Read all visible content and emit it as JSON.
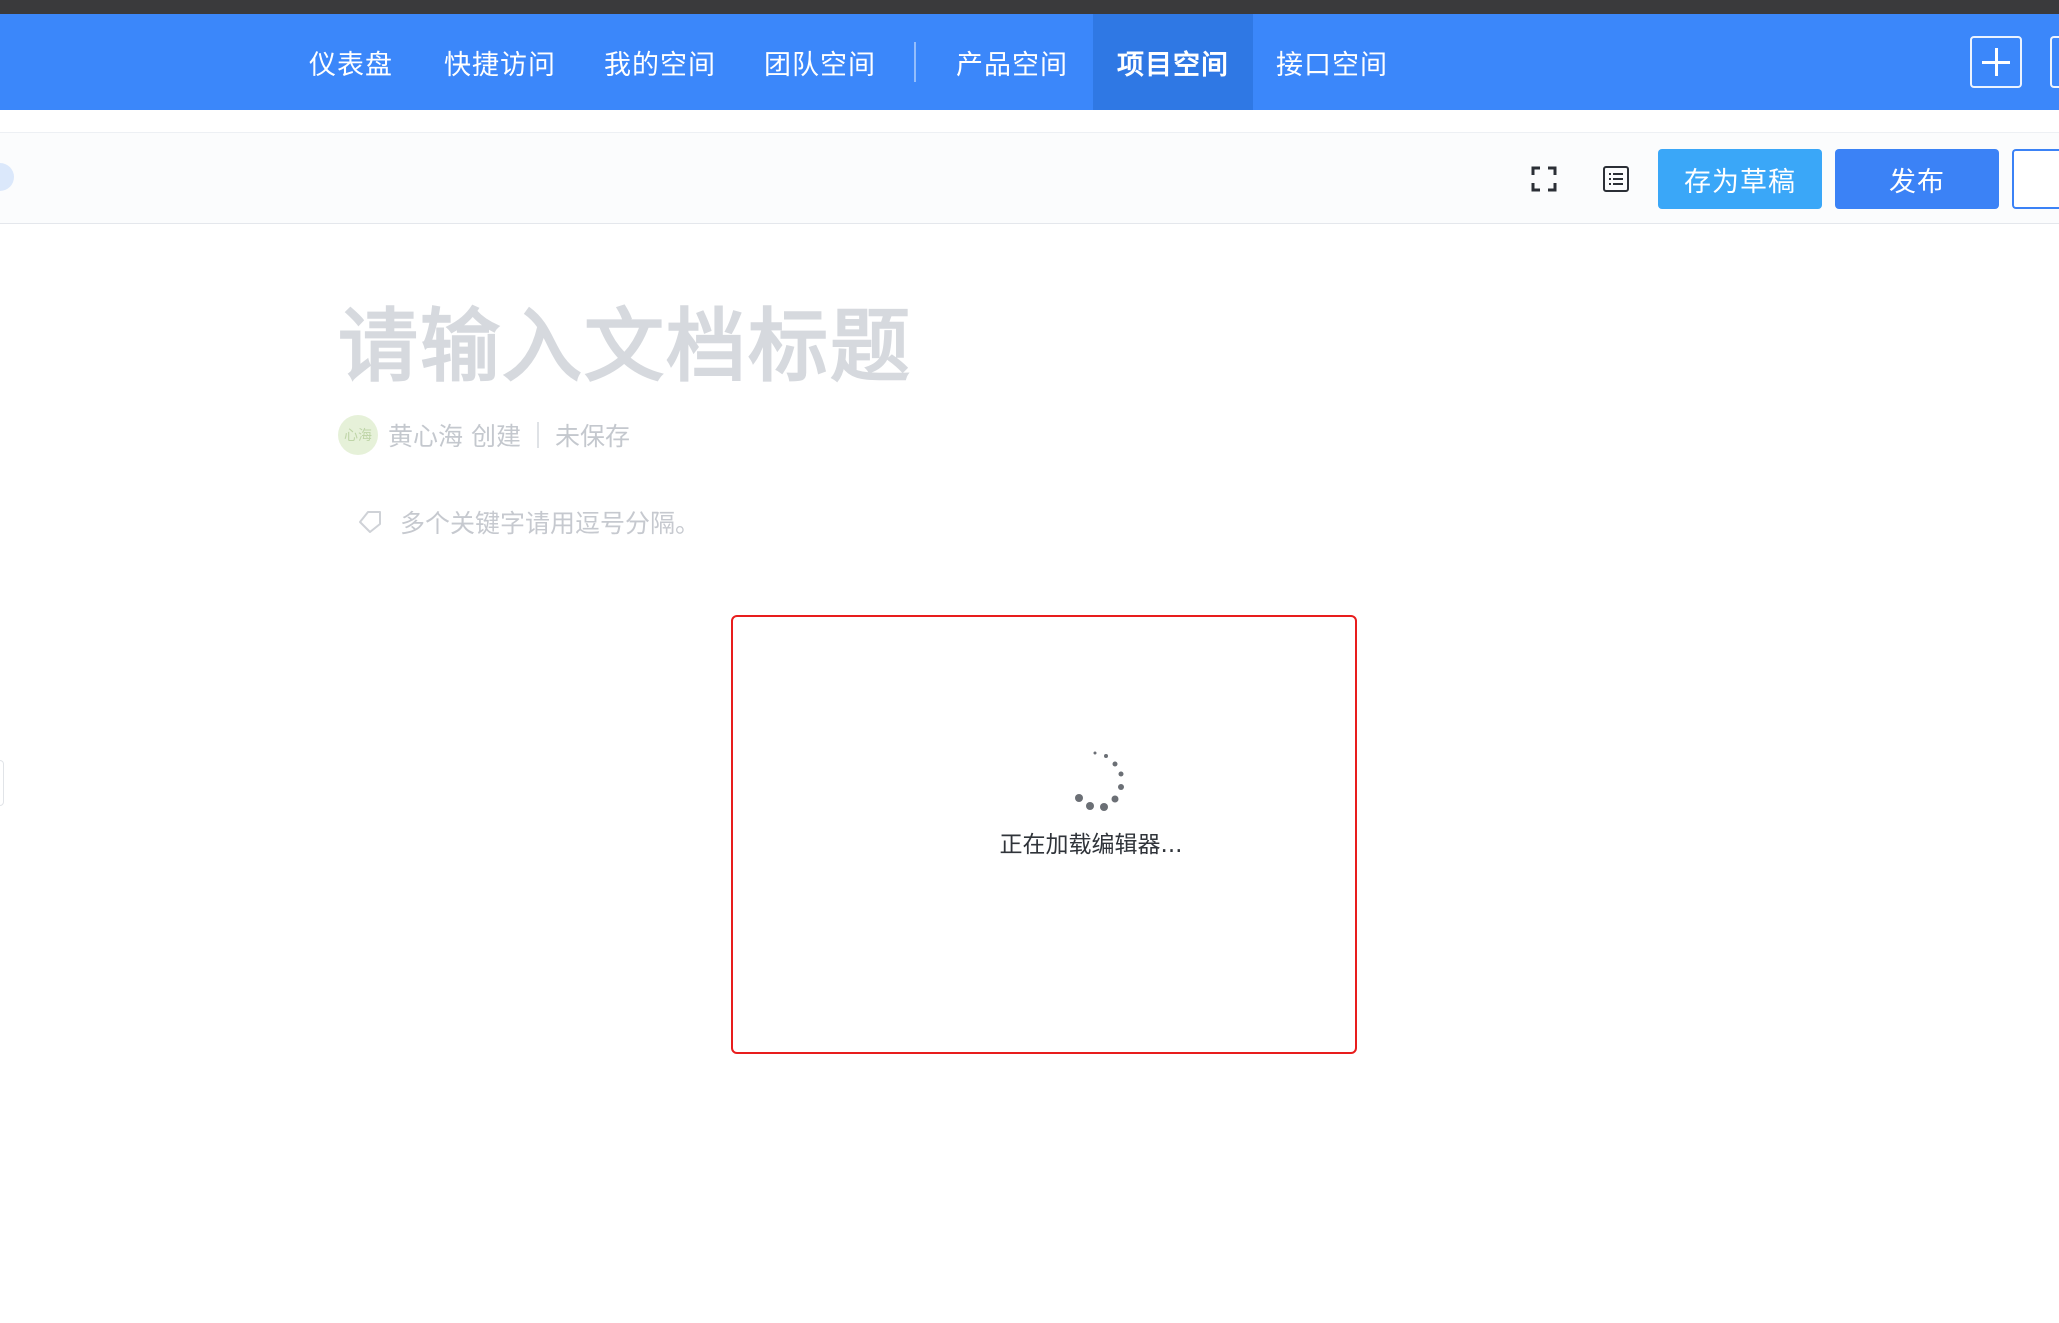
{
  "nav": {
    "items": [
      {
        "label": "仪表盘",
        "active": false
      },
      {
        "label": "快捷访问",
        "active": false
      },
      {
        "label": "我的空间",
        "active": false
      },
      {
        "label": "团队空间",
        "active": false
      },
      {
        "label": "产品空间",
        "active": false
      },
      {
        "label": "项目空间",
        "active": true
      },
      {
        "label": "接口空间",
        "active": false
      }
    ],
    "add_icon": "plus-icon"
  },
  "toolbar": {
    "fullscreen_icon": "fullscreen-icon",
    "outline_icon": "outline-icon",
    "save_draft_label": "存为草稿",
    "publish_label": "发布"
  },
  "document": {
    "title_placeholder": "请输入文档标题",
    "author_avatar": "心海",
    "author_name": "黄心海",
    "created_label": "创建",
    "save_status": "未保存",
    "tags_placeholder": "多个关键字请用逗号分隔。"
  },
  "editor": {
    "loading_text": "正在加载编辑器..."
  },
  "colors": {
    "nav_bg": "#3b87fa",
    "nav_active_bg": "#2f78e4",
    "draft_button": "#3aa7f8",
    "publish_button": "#3b82f6",
    "editor_border": "#e81d1d"
  }
}
